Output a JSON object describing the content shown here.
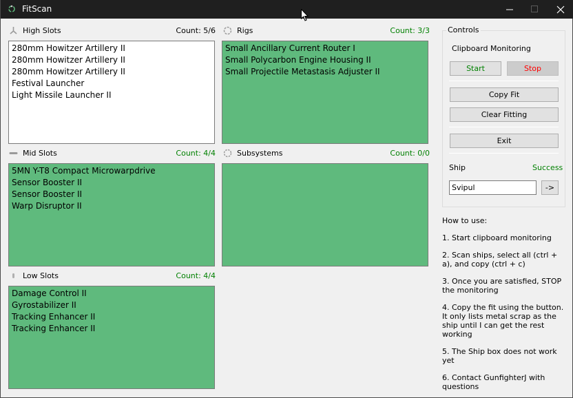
{
  "window": {
    "title": "FitScan",
    "controls": [
      "minimize",
      "maximize",
      "close"
    ]
  },
  "colors": {
    "titlebar": "#1f1f1f",
    "panel_green": "#5fba7d",
    "count_green": "#008000",
    "stop_red": "#ff0000"
  },
  "slots": {
    "high": {
      "label": "High Slots",
      "count": "Count: 5/6",
      "count_color": "#000000",
      "icon": "high-slot-icon",
      "items": [
        "280mm Howitzer Artillery II",
        "280mm Howitzer Artillery II",
        "280mm Howitzer Artillery II",
        "Festival Launcher",
        "Light Missile Launcher II"
      ]
    },
    "rigs": {
      "label": "Rigs",
      "count": "Count: 3/3",
      "count_color": "#008000",
      "icon": "rig-icon",
      "items": [
        "Small Ancillary Current Router I",
        "Small Polycarbon Engine Housing II",
        "Small Projectile Metastasis Adjuster II"
      ]
    },
    "mid": {
      "label": "Mid Slots",
      "count": "Count: 4/4",
      "count_color": "#008000",
      "icon": "mid-slot-icon",
      "items": [
        "5MN Y-T8 Compact Microwarpdrive",
        "Sensor Booster II",
        "Sensor Booster II",
        "Warp Disruptor II"
      ]
    },
    "subsystems": {
      "label": "Subsystems",
      "count": "Count: 0/0",
      "count_color": "#008000",
      "icon": "subsystem-icon",
      "items": []
    },
    "low": {
      "label": "Low Slots",
      "count": "Count: 4/4",
      "count_color": "#008000",
      "icon": "low-slot-icon",
      "items": [
        "Damage Control II",
        "Gyrostabilizer II",
        "Tracking Enhancer II",
        "Tracking Enhancer II"
      ]
    }
  },
  "controls": {
    "group_label": "Controls",
    "clipboard_label": "Clipboard Monitoring",
    "start_label": "Start",
    "stop_label": "Stop",
    "copy_fit_label": "Copy Fit",
    "clear_fitting_label": "Clear Fitting",
    "exit_label": "Exit",
    "ship_label": "Ship",
    "ship_status": "Success",
    "ship_value": "Svipul",
    "go_label": "->"
  },
  "howto": {
    "title": "How to use:",
    "steps": [
      "1. Start clipboard monitoring",
      "2. Scan ships, select all (ctrl + a), and copy (ctrl + c)",
      "3. Once you are satisfied, STOP the monitoring",
      "4. Copy the fit using the button. It only lists metal scrap as the ship until I can get the rest working",
      "5. The Ship box does not work yet",
      "6. Contact GunfighterJ with questions"
    ]
  }
}
